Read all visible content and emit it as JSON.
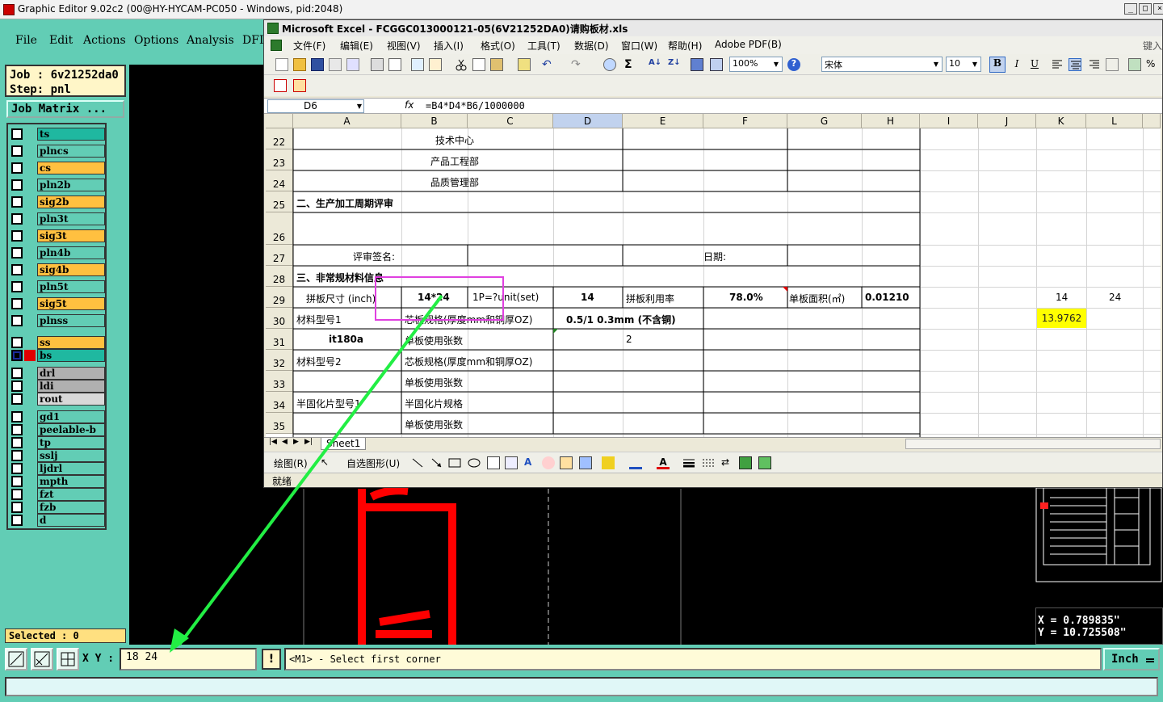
{
  "outer_window": {
    "title": "Graphic Editor 9.02c2 (00@HY-HYCAM-PC050 - Windows, pid:2048)",
    "controls": [
      "_",
      "□",
      "×"
    ]
  },
  "outer_menu": [
    "File",
    "Edit",
    "Actions",
    "Options",
    "Analysis",
    "DFI"
  ],
  "job": {
    "job_line": "Job : 6v21252da0",
    "step_line": "Step: pnl",
    "matrix_button": "Job Matrix ..."
  },
  "layers": [
    {
      "name": "ts",
      "color": "#1fb8a0"
    },
    {
      "name": "plncs",
      "color": "#62cdb5"
    },
    {
      "name": "cs",
      "color": "#ffc040"
    },
    {
      "name": "pln2b",
      "color": "#62cdb5"
    },
    {
      "name": "sig2b",
      "color": "#ffc040"
    },
    {
      "name": "pln3t",
      "color": "#62cdb5"
    },
    {
      "name": "sig3t",
      "color": "#ffc040"
    },
    {
      "name": "pln4b",
      "color": "#62cdb5"
    },
    {
      "name": "sig4b",
      "color": "#ffc040"
    },
    {
      "name": "pln5t",
      "color": "#62cdb5"
    },
    {
      "name": "sig5t",
      "color": "#ffc040"
    },
    {
      "name": "plnss",
      "color": "#62cdb5"
    },
    {
      "name": "ss",
      "color": "#ffc040"
    },
    {
      "name": "bs",
      "color": "#1fb8a0"
    },
    {
      "name": "drl",
      "color": "#b0b0b0"
    },
    {
      "name": "ldi",
      "color": "#b0b0b0"
    },
    {
      "name": "rout",
      "color": "#d8d8d8"
    },
    {
      "name": "gd1",
      "color": "#62cdb5"
    },
    {
      "name": "peelable-b",
      "color": "#62cdb5"
    },
    {
      "name": "tp",
      "color": "#62cdb5"
    },
    {
      "name": "sslj",
      "color": "#62cdb5"
    },
    {
      "name": "ljdrl",
      "color": "#62cdb5"
    },
    {
      "name": "mpth",
      "color": "#62cdb5"
    },
    {
      "name": "fzt",
      "color": "#62cdb5"
    },
    {
      "name": "fzb",
      "color": "#62cdb5"
    },
    {
      "name": "d",
      "color": "#62cdb5"
    }
  ],
  "selected_text": "Selected : 0",
  "bottom": {
    "xy_label": "X Y :",
    "xy_value": "18 24",
    "excl": "!",
    "prompt": "<M1> - Select first corner",
    "unit": "Inch"
  },
  "coords": {
    "x": "X = 0.789835\"",
    "y": "Y = 10.725508\""
  },
  "excel": {
    "title": "Microsoft Excel - FCGGC013000121-05(6V21252DA0)请购板材.xls",
    "menus": [
      "文件(F)",
      "编辑(E)",
      "视图(V)",
      "插入(I)",
      "格式(O)",
      "工具(T)",
      "数据(D)",
      "窗口(W)",
      "帮助(H)",
      "Adobe PDF(B)"
    ],
    "help_box": "键入",
    "zoom": "100%",
    "font": "宋体",
    "font_size": "10",
    "name_box": "D6",
    "fx": "fx",
    "formula": "=B4*D4*B6/1000000",
    "columns": [
      "A",
      "B",
      "C",
      "D",
      "E",
      "F",
      "G",
      "H",
      "I",
      "J",
      "K",
      "L"
    ],
    "selected_col": "D",
    "rows": [
      "22",
      "23",
      "24",
      "25",
      "26",
      "27",
      "28",
      "29",
      "30",
      "31",
      "32",
      "33",
      "34",
      "35"
    ],
    "cells": {
      "r22": "技术中心",
      "r23": "产品工程部",
      "r24": "品质管理部",
      "r25": "二、生产加工周期评审",
      "r27a": "评审签名:",
      "r27f": "日期:",
      "r28": "三、非常规材料信息",
      "r29a": "拼板尺寸 (inch)",
      "r29b": "14*24",
      "r29c": "1P=?unit(set)",
      "r29d": "14",
      "r29e": "拼板利用率",
      "r29f": "78.0%",
      "r29g": "单板面积(㎡)",
      "r29h": "0.01210",
      "r29k": "14",
      "r29l": "24",
      "r30a": "材料型号1",
      "r30b": "芯板规格(厚度mm和铜厚OZ)",
      "r30d": "0.5/1 0.3mm (不含铜)",
      "r30k": "13.9762",
      "r31a": "it180a",
      "r31b": "单板使用张数",
      "r31d": "2",
      "r32a": "材料型号2",
      "r32b": "芯板规格(厚度mm和铜厚OZ)",
      "r33b": "单板使用张数",
      "r34a": "半固化片型号1",
      "r34b": "半固化片规格",
      "r35b": "单板使用张数"
    },
    "sheet_tab": "Sheet1",
    "draw_label": "绘图(R)",
    "autoshape_label": "自选图形(U)",
    "status": "就绪"
  },
  "colors": {
    "teal_bg": "#62cdb5",
    "highlight_yellow": "#ffff00",
    "annotation_magenta": "#e040e0",
    "annotation_green": "#22ee44",
    "pad_red": "#ff0000"
  }
}
